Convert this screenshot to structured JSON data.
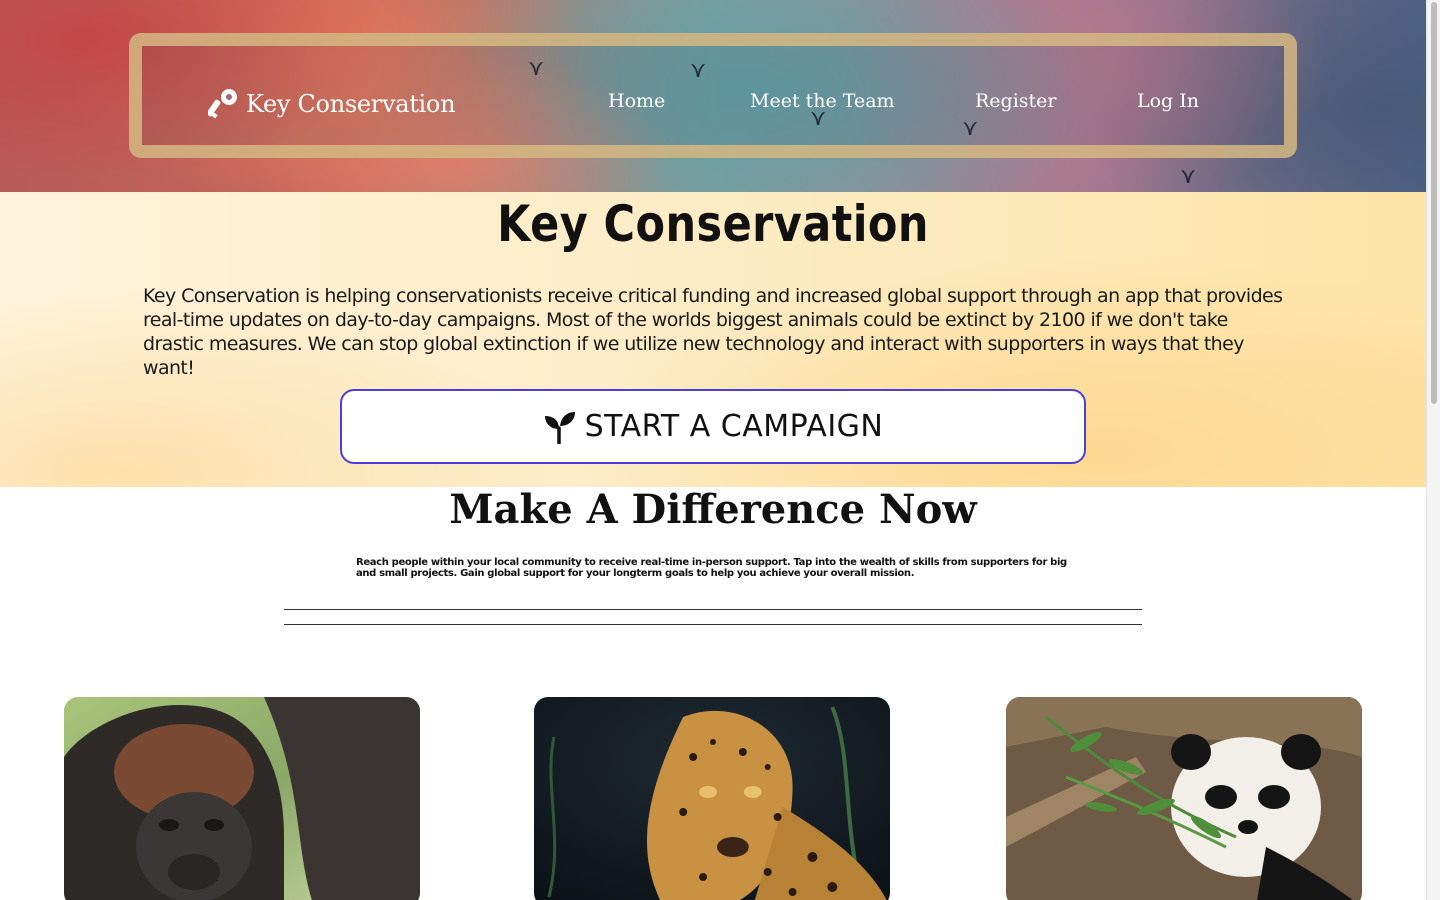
{
  "header": {
    "brand": "Key Conservation",
    "brand_icon": "key-icon",
    "nav": [
      {
        "label": "Home"
      },
      {
        "label": "Meet the Team"
      },
      {
        "label": "Register"
      },
      {
        "label": "Log In"
      }
    ]
  },
  "intro": {
    "title": "Key Conservation",
    "paragraph": "Key Conservation is helping conservationists receive critical funding and increased global support through an app that provides real-time updates on day-to-day campaigns. Most of the worlds biggest animals could be extinct by 2100 if we don't take drastic measures. We can stop global extinction if we utilize new technology and interact with supporters in ways that they want!",
    "cta_icon": "sprout-icon",
    "cta_label": "START A CAMPAIGN"
  },
  "difference": {
    "title": "Make A Difference Now",
    "paragraph": "Reach people within your local community to receive real-time in-person support. Tap into the wealth of skills from supporters for big and small projects. Gain global support for your longterm goals to help you achieve your overall mission."
  },
  "cards": [
    {
      "animal": "gorilla"
    },
    {
      "animal": "leopard"
    },
    {
      "animal": "panda"
    }
  ],
  "colors": {
    "cta_border": "#4a3fd8",
    "nav_frame": "#d6b982",
    "intro_band": "#fde4a8"
  }
}
